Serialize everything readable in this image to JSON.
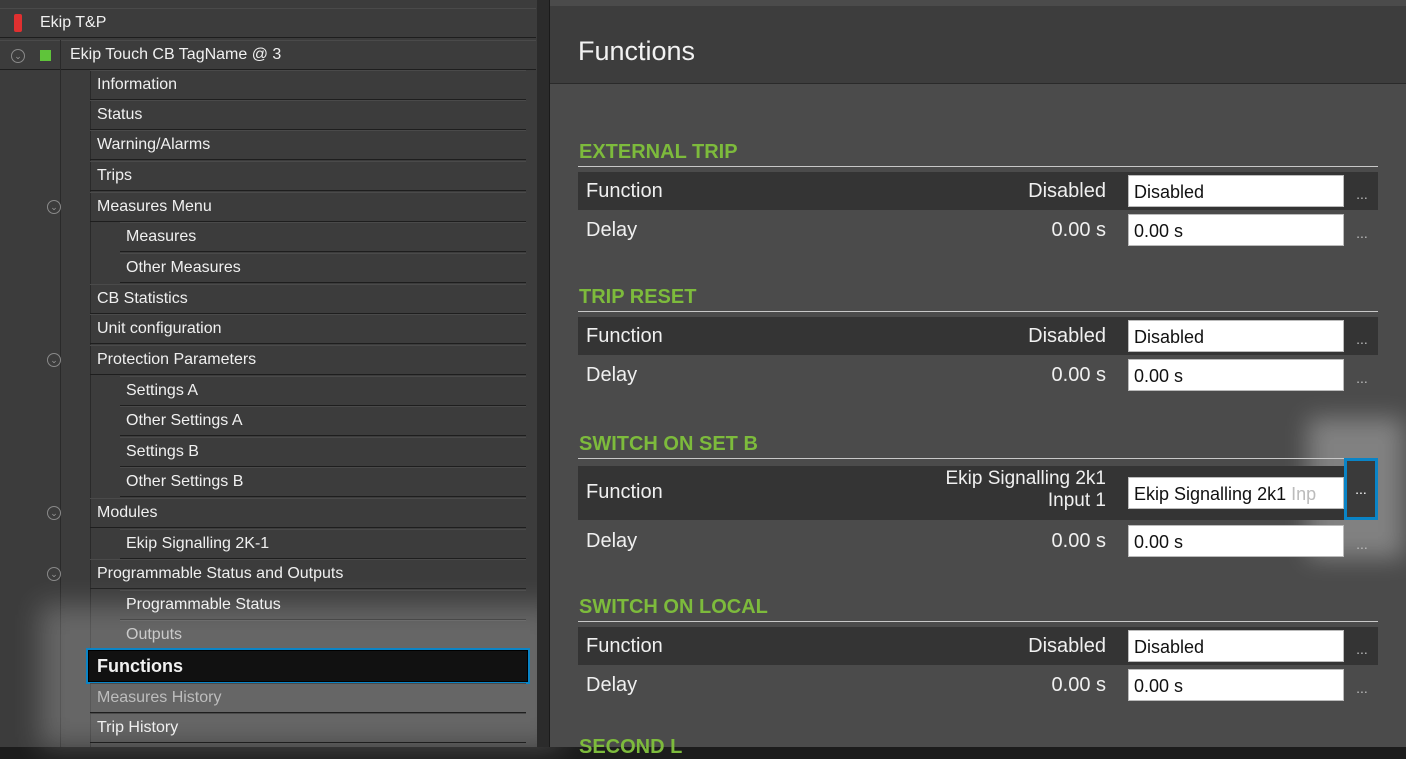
{
  "tree": {
    "root": "Ekip T&P",
    "device": "Ekip Touch CB TagName @ 3",
    "items": [
      {
        "label": "Information"
      },
      {
        "label": "Status"
      },
      {
        "label": "Warning/Alarms"
      },
      {
        "label": "Trips"
      },
      {
        "label": "Measures Menu"
      },
      {
        "label": "Measures"
      },
      {
        "label": "Other Measures"
      },
      {
        "label": "CB Statistics"
      },
      {
        "label": "Unit configuration"
      },
      {
        "label": "Protection Parameters"
      },
      {
        "label": "Settings A"
      },
      {
        "label": "Other Settings A"
      },
      {
        "label": "Settings B"
      },
      {
        "label": "Other Settings B"
      },
      {
        "label": "Modules"
      },
      {
        "label": "Ekip Signalling 2K-1"
      },
      {
        "label": "Programmable Status and Outputs"
      },
      {
        "label": "Programmable Status"
      },
      {
        "label": "Outputs"
      },
      {
        "label": "Functions"
      },
      {
        "label": "Measures History"
      },
      {
        "label": "Trip History"
      }
    ]
  },
  "page": {
    "title": "Functions"
  },
  "sections": [
    {
      "title": "EXTERNAL TRIP",
      "function": {
        "label": "Function",
        "value": "Disabled",
        "input": "Disabled"
      },
      "delay": {
        "label": "Delay",
        "value": "0.00 s",
        "input": "0.00 s"
      }
    },
    {
      "title": "TRIP RESET",
      "function": {
        "label": "Function",
        "value": "Disabled",
        "input": "Disabled"
      },
      "delay": {
        "label": "Delay",
        "value": "0.00 s",
        "input": "0.00 s"
      }
    },
    {
      "title": "SWITCH ON SET B",
      "function": {
        "label": "Function",
        "value_line1": "Ekip Signalling 2k1",
        "value_line2": "Input 1",
        "input": "Ekip Signalling 2k1",
        "input_fade": "Inp"
      },
      "delay": {
        "label": "Delay",
        "value": "0.00 s",
        "input": "0.00 s"
      }
    },
    {
      "title": "SWITCH ON LOCAL",
      "function": {
        "label": "Function",
        "value": "Disabled",
        "input": "Disabled"
      },
      "delay": {
        "label": "Delay",
        "value": "0.00 s",
        "input": "0.00 s"
      }
    }
  ],
  "ellipsis": "...",
  "next_section_partial": "SECOND L"
}
